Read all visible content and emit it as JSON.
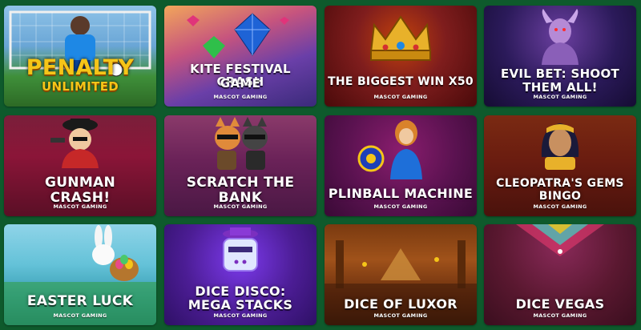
{
  "games": [
    {
      "title_line1": "PENALTY",
      "title_line2": "UNLIMITED",
      "provider": ""
    },
    {
      "title_line1": "KITE FESTIVAL CRASH",
      "title_line2": "GAME",
      "provider": "MASCOT GAMING"
    },
    {
      "title_line1": "THE BIGGEST WIN X50",
      "title_line2": "",
      "provider": "MASCOT GAMING"
    },
    {
      "title_line1": "EVIL BET: SHOOT",
      "title_line2": "THEM ALL!",
      "provider": "MASCOT GAMING"
    },
    {
      "title_line1": "GUNMAN",
      "title_line2": "CRASH!",
      "provider": "MASCOT GAMING"
    },
    {
      "title_line1": "SCRATCH THE",
      "title_line2": "BANK",
      "provider": "MASCOT GAMING"
    },
    {
      "title_line1": "PLINBALL MACHINE",
      "title_line2": "",
      "provider": "MASCOT GAMING"
    },
    {
      "title_line1": "CLEOPATRA'S GEMS",
      "title_line2": "BINGO",
      "provider": "MASCOT GAMING"
    },
    {
      "title_line1": "EASTER LUCK",
      "title_line2": "",
      "provider": "MASCOT GAMING"
    },
    {
      "title_line1": "DICE DISCO:",
      "title_line2": "MEGA STACKS",
      "provider": "MASCOT GAMING"
    },
    {
      "title_line1": "DICE OF LUXOR",
      "title_line2": "",
      "provider": "MASCOT GAMING"
    },
    {
      "title_line1": "DICE VEGAS",
      "title_line2": "",
      "provider": "MASCOT GAMING"
    }
  ],
  "colors": {
    "page_background": "#0e5a2c",
    "title_text": "#ffffff",
    "penalty_gold": "#f5c518"
  },
  "icons": [
    "goal-net-icon",
    "kite-icon",
    "crown-icon",
    "demon-icon",
    "gunman-icon",
    "cats-icon",
    "plinko-ball-icon",
    "cleopatra-icon",
    "bunny-icon",
    "disco-cube-icon",
    "pyramid-icon",
    "dice-icon"
  ]
}
